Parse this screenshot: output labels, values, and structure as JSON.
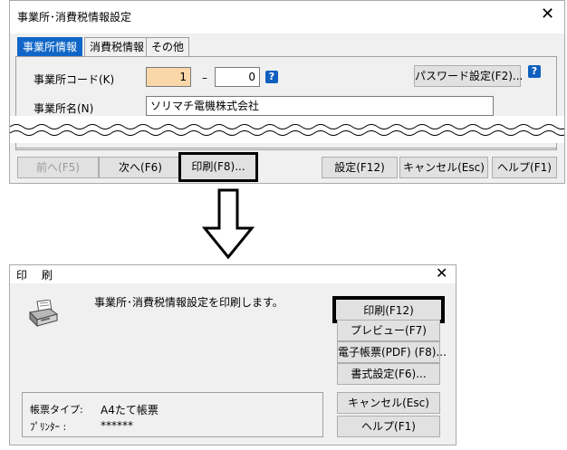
{
  "settings_dialog": {
    "title": "事業所･消費税情報設定",
    "close_symbol": "✕",
    "tabs": [
      "事業所情報",
      "消費税情報",
      "その他"
    ],
    "office_code_label": "事業所コード(K)",
    "office_code_from": "1",
    "range_dash": "–",
    "office_code_to": "0",
    "help_mark": "?",
    "password_button": "パスワード設定(F2)...",
    "office_name_label": "事業所名(N)",
    "office_name_value": "ソリマチ電機株式会社",
    "buttons": {
      "prev": "前へ(F5)",
      "next": "次へ(F6)",
      "print": "印刷(F8)...",
      "settings": "設定(F12)",
      "cancel": "キャンセル(Esc)",
      "help": "ヘルプ(F1)"
    }
  },
  "print_dialog": {
    "title": "印 刷",
    "close_symbol": "✕",
    "message": "事業所･消費税情報設定を印刷します。",
    "form_type_label": "帳票タイプ:",
    "form_type_value": "A4たて帳票",
    "printer_label": "ﾌﾟﾘﾝﾀｰ :",
    "printer_value": "******",
    "buttons": {
      "print": "印刷(F12)",
      "preview": "プレビュー(F7)",
      "e_form": "電子帳票(PDF) (F8)...",
      "format_settings": "書式設定(F6)...",
      "cancel": "キャンセル(Esc)",
      "help": "ヘルプ(F1)"
    }
  },
  "colors": {
    "active_tab": "#1066c8",
    "help_icon": "#1060c0",
    "highlight_border": "#000000",
    "focused_field": "#f9d7a8"
  },
  "icons": [
    "question-icon",
    "printer-icon",
    "down-arrow-icon",
    "close-icon"
  ]
}
